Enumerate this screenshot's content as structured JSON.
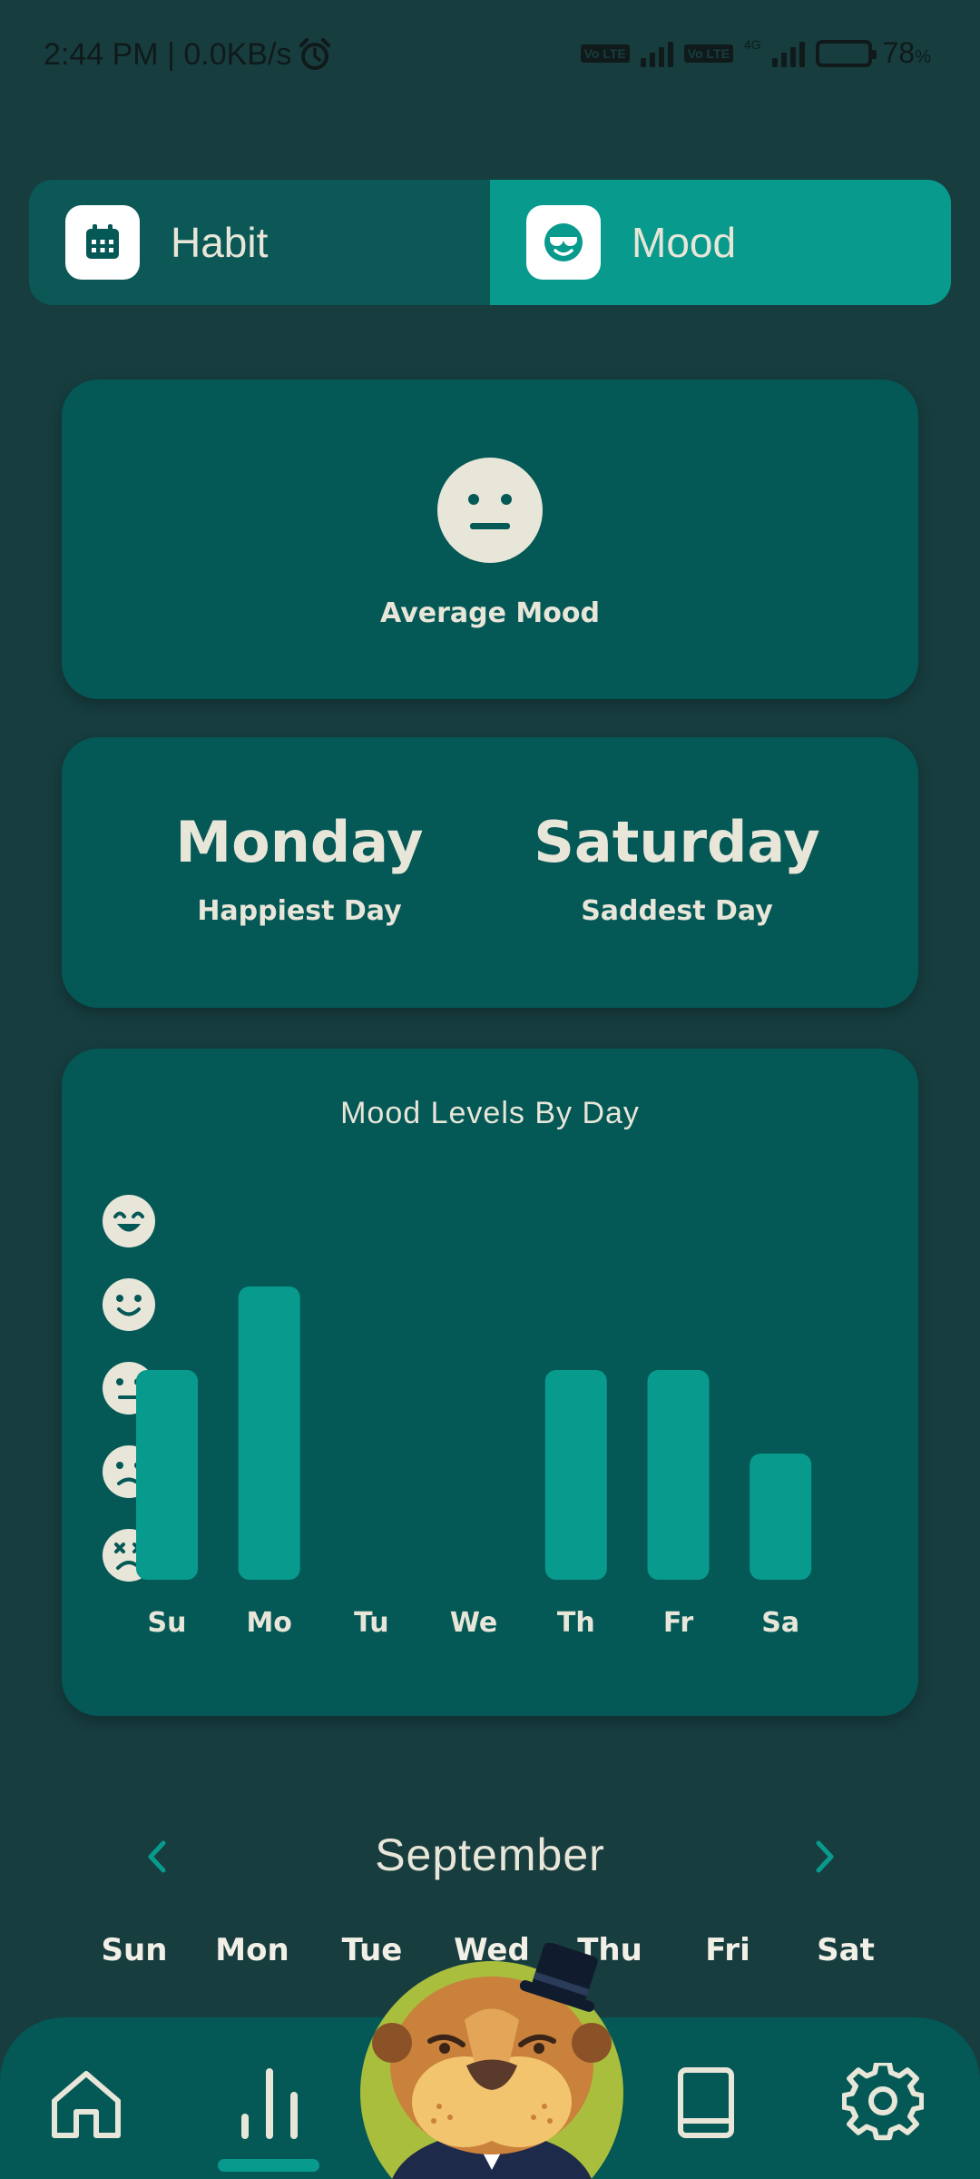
{
  "status_bar": {
    "time_speed": "2:44 PM | 0.0KB/s",
    "volte_1": "Vo LTE",
    "volte_2": "Vo LTE",
    "network": "4G",
    "battery_percent": "78",
    "battery_percent_unit": "%",
    "battery_level": 0.78
  },
  "tabs": [
    {
      "label": "Habit",
      "icon": "calendar-icon",
      "active": false
    },
    {
      "label": "Mood",
      "icon": "cool-face-icon",
      "active": true
    }
  ],
  "average_mood": {
    "label": "Average Mood",
    "face": "neutral-face-icon"
  },
  "summary": {
    "happiest_day": "Monday",
    "happiest_label": "Happiest Day",
    "saddest_day": "Saturday",
    "saddest_label": "Saddest Day"
  },
  "chart_data": {
    "type": "bar",
    "title": "Mood Levels By Day",
    "categories": [
      "Su",
      "Mo",
      "Tu",
      "We",
      "Th",
      "Fr",
      "Sa"
    ],
    "values": [
      3,
      4,
      0,
      0,
      3,
      3,
      2
    ],
    "ylim": [
      0,
      5
    ],
    "y_levels": [
      "awful-face-icon",
      "sad-face-icon",
      "neutral-face-icon",
      "happy-face-icon",
      "great-face-icon"
    ],
    "bar_color": "#089A8D",
    "grid": false
  },
  "calendar": {
    "month": "September",
    "weekdays": [
      "Sun",
      "Mon",
      "Tue",
      "Wed",
      "Thu",
      "Fri",
      "Sat"
    ]
  },
  "bottom_nav": {
    "items": [
      "home-icon",
      "stats-icon",
      "mascot-otter",
      "book-icon",
      "settings-icon"
    ],
    "active": "stats-icon"
  },
  "colors": {
    "background": "#173D3F",
    "card": "#045856",
    "accent": "#089A8D",
    "text": "#E8E6D8"
  }
}
